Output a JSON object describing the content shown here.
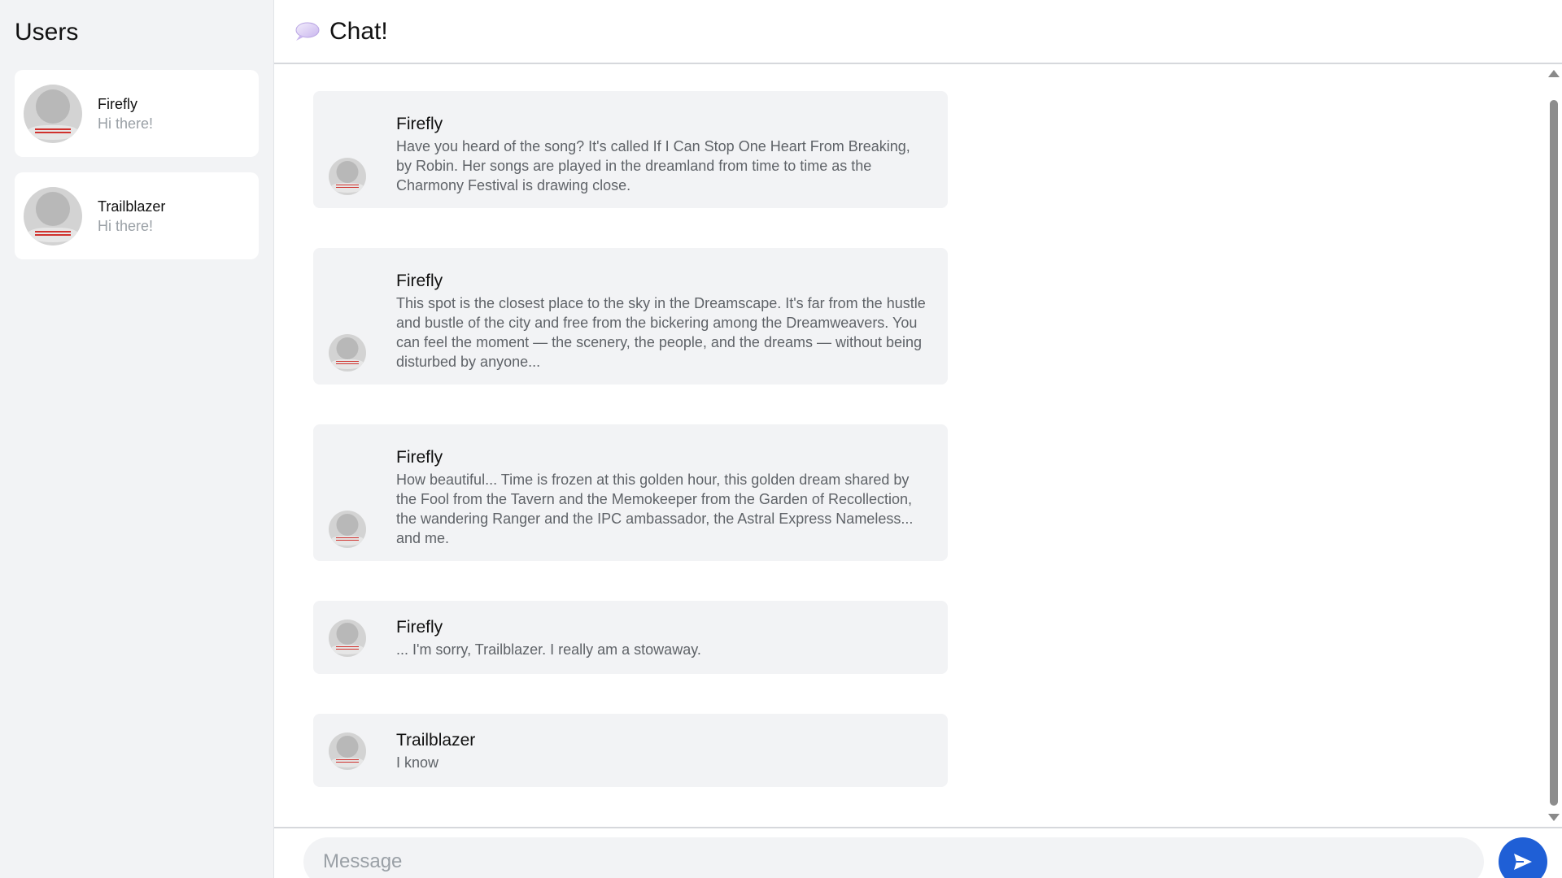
{
  "sidebar": {
    "title": "Users",
    "users": [
      {
        "name": "Firefly",
        "preview": "Hi there!"
      },
      {
        "name": "Trailblazer",
        "preview": "Hi there!"
      }
    ]
  },
  "header": {
    "title": "Chat!",
    "icon": "speech-bubble-icon"
  },
  "messages": [
    {
      "author": "Firefly",
      "text": "Have you heard of the song? It's called If I Can Stop One Heart From Breaking, by Robin. Her songs are played in the dreamland from time to time as the Charmony Festival is drawing close."
    },
    {
      "author": "Firefly",
      "text": "This spot is the closest place to the sky in the Dreamscape. It's far from the hustle and bustle of the city and free from the bickering among the Dreamweavers. You can feel the moment — the scenery, the people, and the dreams — without being disturbed by anyone..."
    },
    {
      "author": "Firefly",
      "text": "How beautiful... Time is frozen at this golden hour, this golden dream shared by the Fool from the Tavern and the Memokeeper from the Garden of Recollection, the wandering Ranger and the IPC ambassador, the Astral Express Nameless... and me."
    },
    {
      "author": "Firefly",
      "text": "... I'm sorry, Trailblazer. I really am a stowaway."
    },
    {
      "author": "Trailblazer",
      "text": "I know"
    }
  ],
  "composer": {
    "placeholder": "Message",
    "value": "",
    "send_icon": "send-icon"
  },
  "colors": {
    "sidebar_bg": "#f2f3f5",
    "bubble_bg": "#f2f3f5",
    "send_button": "#1f5fd6",
    "muted_text": "#9aa0a6"
  }
}
